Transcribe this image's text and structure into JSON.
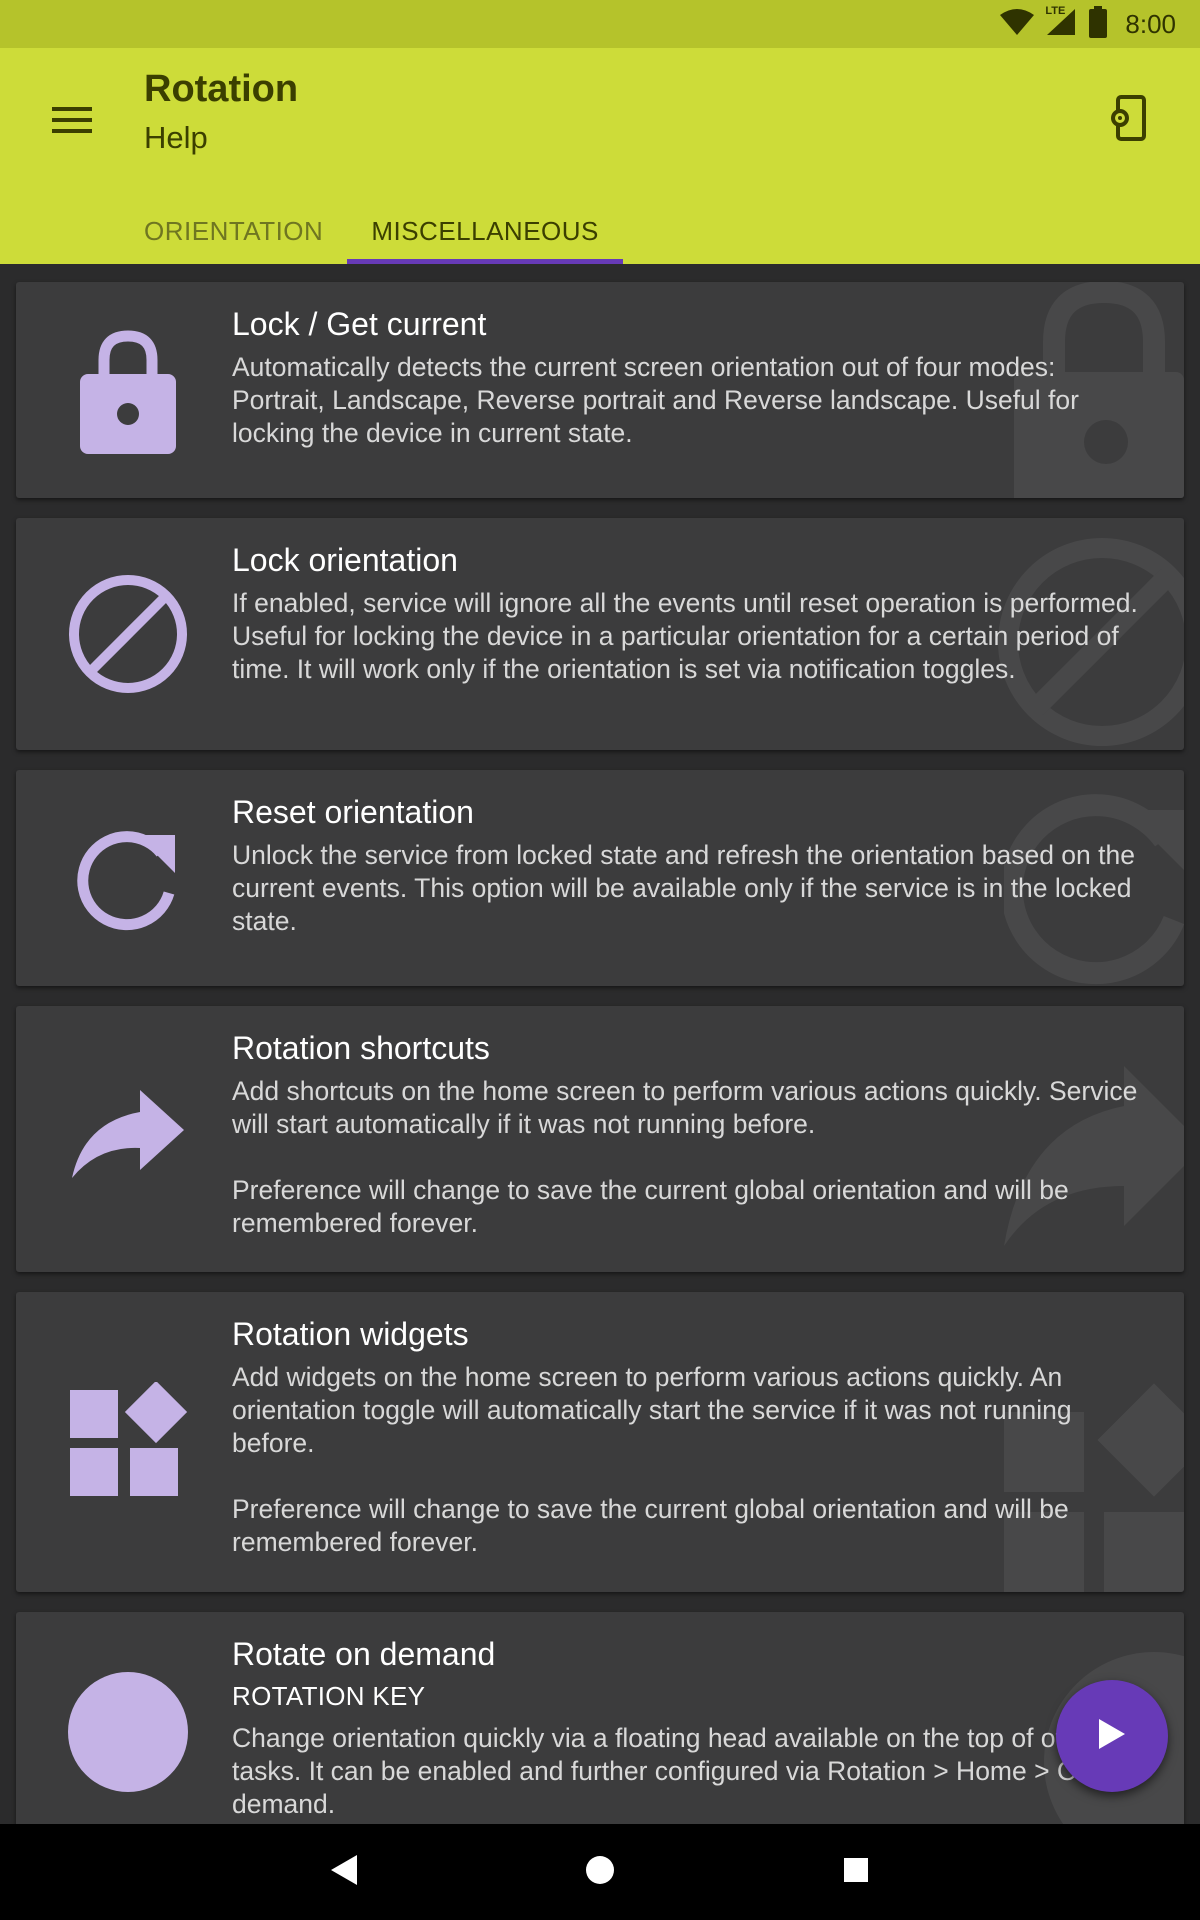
{
  "status_bar": {
    "time": "8:00",
    "network_label": "LTE"
  },
  "app_bar": {
    "title": "Rotation",
    "subtitle": "Help"
  },
  "tabs": [
    {
      "label": "ORIENTATION",
      "active": false
    },
    {
      "label": "MISCELLANEOUS",
      "active": true
    }
  ],
  "cards": [
    {
      "icon": "lock-icon",
      "title": "Lock / Get current",
      "description": "Automatically detects the current screen orientation out of four modes: Portrait, Landscape, Reverse portrait and Reverse landscape. Useful for locking the device in current state."
    },
    {
      "icon": "block-icon",
      "title": "Lock orientation",
      "description": "If enabled, service will ignore all the events until reset operation is performed. Useful for locking the device in a particular orientation for a certain period of time. It will work only if the orientation is set via notification toggles."
    },
    {
      "icon": "refresh-icon",
      "title": "Reset orientation",
      "description": "Unlock the service from locked state and refresh the orientation based on the current events. This option will be available only if the service is in the locked state."
    },
    {
      "icon": "share-arrow-icon",
      "title": "Rotation shortcuts",
      "description": "Add shortcuts on the home screen to perform various actions quickly. Service will start automatically if it was not running before.\n\nPreference will change to save the current global orientation and will be remembered forever."
    },
    {
      "icon": "widgets-icon",
      "title": "Rotation widgets",
      "description": "Add widgets on the home screen to perform various actions quickly. An orientation toggle will automatically start the service if it was not running before.\n\nPreference will change to save the current global orientation and will be remembered forever."
    },
    {
      "icon": "circle-icon",
      "title": "Rotate on demand",
      "subtitle": "ROTATION KEY",
      "description": "Change orientation quickly via a floating head available on the top of other tasks. It can be enabled and further configured via Rotation > Home > On demand."
    }
  ],
  "colors": {
    "status_bar": "#b5c32b",
    "app_bar": "#cddc39",
    "accent": "#673ab7",
    "icon_tint": "#c5b3e6",
    "card": "#3c3c3d",
    "background": "#2b2b2c"
  }
}
